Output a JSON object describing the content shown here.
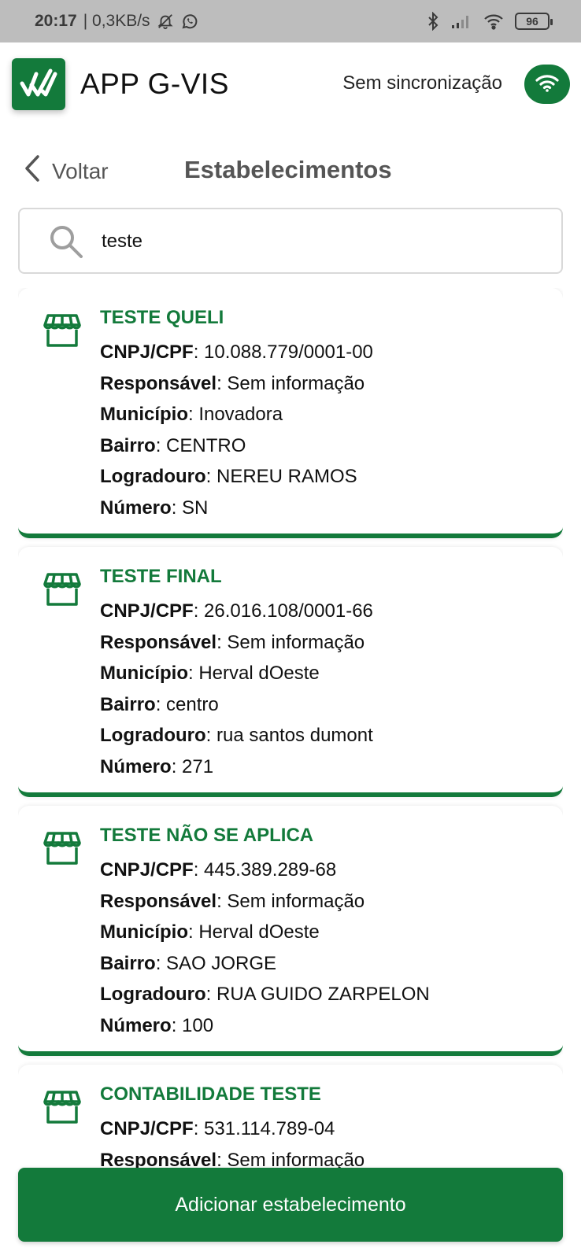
{
  "status_bar": {
    "time": "20:17",
    "net_speed": "| 0,3KB/s",
    "battery": "96"
  },
  "app": {
    "title": "APP G-VIS",
    "sync_label": "Sem sincronização"
  },
  "nav": {
    "back_label": "Voltar",
    "page_title": "Estabelecimentos"
  },
  "search": {
    "value": "teste"
  },
  "labels": {
    "cnpj": "CNPJ/CPF",
    "responsavel": "Responsável",
    "municipio": "Município",
    "bairro": "Bairro",
    "logradouro": "Logradouro",
    "numero": "Número"
  },
  "establishments": [
    {
      "name": "TESTE QUELI",
      "cnpj": ": 10.088.779/0001-00",
      "responsavel": ": Sem informação",
      "municipio": ": Inovadora",
      "bairro": ": CENTRO",
      "logradouro": ": NEREU RAMOS",
      "numero": ": SN"
    },
    {
      "name": "TESTE FINAL",
      "cnpj": ": 26.016.108/0001-66",
      "responsavel": ": Sem informação",
      "municipio": ": Herval dOeste",
      "bairro": ": centro",
      "logradouro": ": rua santos dumont",
      "numero": ": 271"
    },
    {
      "name": "TESTE NÃO SE APLICA",
      "cnpj": ": 445.389.289-68",
      "responsavel": ": Sem informação",
      "municipio": ": Herval dOeste",
      "bairro": ": SAO JORGE",
      "logradouro": ": RUA GUIDO ZARPELON",
      "numero": ": 100"
    },
    {
      "name": "CONTABILIDADE TESTE",
      "cnpj": ": 531.114.789-04",
      "responsavel": ": Sem informação"
    }
  ],
  "footer": {
    "add_label": "Adicionar estabelecimento"
  },
  "colors": {
    "brand_green": "#137a3b",
    "status_bar_bg": "#bdbdbd"
  },
  "icons": {
    "logo": "check-marks-logo-icon",
    "sync": "wifi-icon",
    "back": "chevron-left-icon",
    "search": "search-icon",
    "establishment": "storefront-icon"
  }
}
